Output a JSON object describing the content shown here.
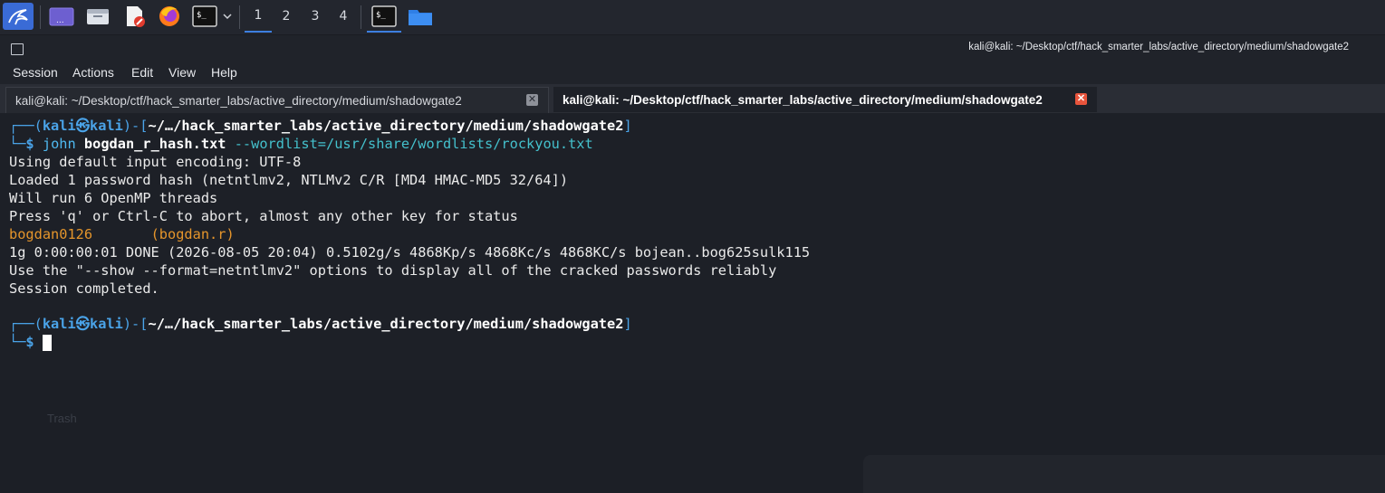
{
  "panel": {
    "workspaces": [
      "1",
      "2",
      "3",
      "4"
    ],
    "active_workspace": "1",
    "icons": [
      "kali-menu-icon",
      "desktop-icon",
      "file-manager-icon",
      "text-editor-icon",
      "firefox-icon",
      "terminal-icon",
      "chevron-down-icon",
      "terminal-task-icon",
      "folder-icon"
    ]
  },
  "window": {
    "title": "kali@kali: ~/Desktop/ctf/hack_smarter_labs/active_directory/medium/shadowgate2",
    "menu": [
      "Session",
      "Actions",
      "Edit",
      "View",
      "Help"
    ],
    "tabs": [
      {
        "label": "kali@kali: ~/Desktop/ctf/hack_smarter_labs/active_directory/medium/shadowgate2",
        "active": false
      },
      {
        "label": "kali@kali: ~/Desktop/ctf/hack_smarter_labs/active_directory/medium/shadowgate2",
        "active": true
      }
    ]
  },
  "terminal": {
    "prompt1": {
      "user": "kali",
      "at": "㉿",
      "host": "kali",
      "path": "~/…/hack_smarter_labs/active_directory/medium/shadowgate2",
      "command": "john",
      "file": "bogdan_r_hash.txt",
      "option": "--wordlist=/usr/share/wordlists/rockyou.txt"
    },
    "output": [
      "Using default input encoding: UTF-8",
      "Loaded 1 password hash (netntlmv2, NTLMv2 C/R [MD4 HMAC-MD5 32/64])",
      "Will run 6 OpenMP threads",
      "Press 'q' or Ctrl-C to abort, almost any other key for status"
    ],
    "cracked": {
      "password": "bogdan0126",
      "user": "(bogdan.r)"
    },
    "output2": [
      "1g 0:00:00:01 DONE (2026-08-05 20:04) 0.5102g/s 4868Kp/s 4868Kc/s 4868KC/s bojean..bog625sulk115",
      "Use the \"--show --format=netntlmv2\" options to display all of the cracked passwords reliably",
      "Session completed."
    ],
    "prompt2": {
      "user": "kali",
      "at": "㉿",
      "host": "kali",
      "path": "~/…/hack_smarter_labs/active_directory/medium/shadowgate2"
    }
  },
  "background": {
    "trash_label": "Trash"
  }
}
